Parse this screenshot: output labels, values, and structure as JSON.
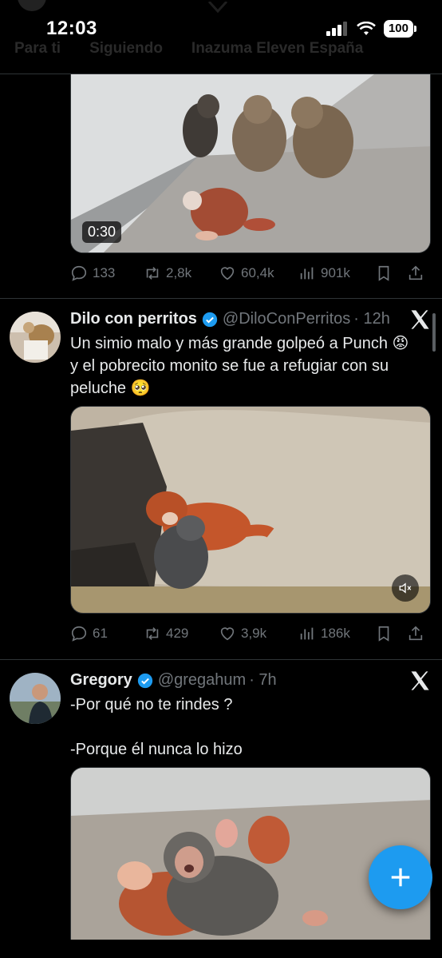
{
  "status_bar": {
    "time": "12:03",
    "battery": "100"
  },
  "header_tabs": [
    "Para ti",
    "Siguiendo",
    "Inazuma Eleven España"
  ],
  "tweets": [
    {
      "video_time": "0:30",
      "stats": {
        "replies": "133",
        "reposts": "2,8k",
        "likes": "60,4k",
        "views": "901k"
      }
    },
    {
      "name": "Dilo con perritos",
      "handle": "@DiloConPerritos",
      "time": "· 12h",
      "text": "Un simio malo y más grande golpeó a Punch 😡\ny el pobrecito monito se fue a refugiar con su\npeluche 🥺",
      "stats": {
        "replies": "61",
        "reposts": "429",
        "likes": "3,9k",
        "views": "186k"
      }
    },
    {
      "name": "Gregory",
      "handle": "@gregahum",
      "time": "· 7h",
      "text": "-Por qué no te rindes ?\n\n-Porque él nunca lo hizo"
    }
  ],
  "icons": {
    "reply": "reply-icon",
    "repost": "repost-icon",
    "like": "heart-icon",
    "views": "views-icon",
    "bookmark": "bookmark-icon",
    "share": "share-icon",
    "compose": "plus-icon",
    "verified": "verified-badge-icon",
    "x": "x-logo-icon"
  },
  "colors": {
    "accent": "#1d9bf0",
    "background": "#000000",
    "muted": "#71767b",
    "text": "#e7e9ea"
  }
}
